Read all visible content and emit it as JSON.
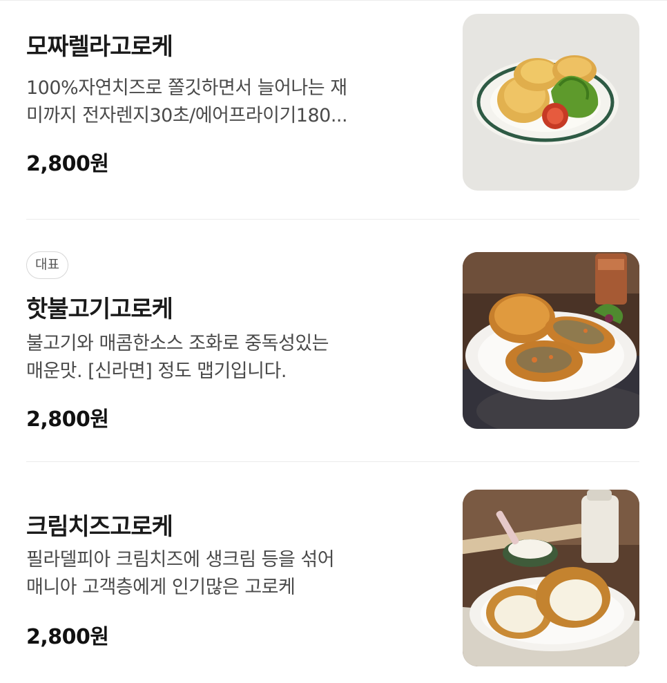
{
  "menu": {
    "items": [
      {
        "badge": "",
        "name": "모짜렐라고로케",
        "desc_line1": "100%자연치즈로 쫄깃하면서 늘어나는 재",
        "desc_line2": "미까지 전자렌지30초/에어프라이기180...",
        "price": "2,800원",
        "image_icon": "mozzarella-croquette-photo"
      },
      {
        "badge": "대표",
        "name": "핫불고기고로케",
        "desc_line1": "불고기와 매콤한소스 조화로 중독성있는",
        "desc_line2": "매운맛. [신라면] 정도 맵기입니다.",
        "price": "2,800원",
        "image_icon": "hot-bulgogi-croquette-photo"
      },
      {
        "badge": "",
        "name": "크림치즈고로케",
        "desc_line1": "필라델피아 크림치즈에 생크림 등을 섞어",
        "desc_line2": "매니아 고객층에게 인기많은 고로케",
        "price": "2,800원",
        "image_icon": "cream-cheese-croquette-photo"
      }
    ]
  }
}
